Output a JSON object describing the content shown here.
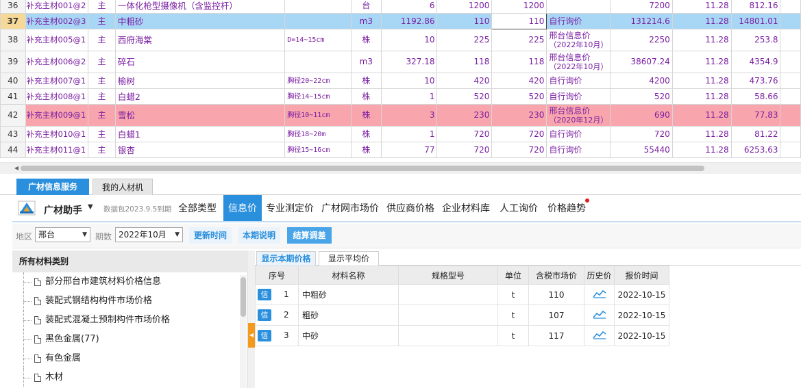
{
  "grid_rows": [
    {
      "row": "36",
      "code": "补充主材001@2",
      "type": "主",
      "name": "一体化枪型摄像机（含监控杆）",
      "spec": "",
      "unit": "台",
      "qty": "6",
      "price1": "1200",
      "price2": "1200",
      "source1": "",
      "source2": "",
      "amount": "7200",
      "rate": "11.28",
      "tax": "812.16",
      "style": "cut"
    },
    {
      "row": "37",
      "code": "补充主材002@3",
      "type": "主",
      "name": "中粗砂",
      "spec": "",
      "unit": "m3",
      "qty": "1192.86",
      "price1": "110",
      "price2": "110",
      "source1": "自行询价",
      "source2": "",
      "amount": "131214.6",
      "rate": "11.28",
      "tax": "14801.01",
      "style": "sel"
    },
    {
      "row": "38",
      "code": "补充主材005@1",
      "type": "主",
      "name": "西府海棠",
      "spec": "D=14~15cm",
      "unit": "株",
      "qty": "10",
      "price1": "225",
      "price2": "225",
      "source1": "邢台信息价",
      "source2": "（2022年10月）",
      "amount": "2250",
      "rate": "11.28",
      "tax": "253.8",
      "style": "tall"
    },
    {
      "row": "39",
      "code": "补充主材006@2",
      "type": "主",
      "name": "碎石",
      "spec": "",
      "unit": "m3",
      "qty": "327.18",
      "price1": "118",
      "price2": "118",
      "source1": "邢台信息价",
      "source2": "（2022年10月）",
      "amount": "38607.24",
      "rate": "11.28",
      "tax": "4354.9",
      "style": "tall"
    },
    {
      "row": "40",
      "code": "补充主材007@1",
      "type": "主",
      "name": "榆树",
      "spec": "胸径20~22cm",
      "unit": "株",
      "qty": "10",
      "price1": "420",
      "price2": "420",
      "source1": "自行询价",
      "source2": "",
      "amount": "4200",
      "rate": "11.28",
      "tax": "473.76",
      "style": "normal"
    },
    {
      "row": "41",
      "code": "补充主材008@1",
      "type": "主",
      "name": "白蜡2",
      "spec": "胸径14~15cm",
      "unit": "株",
      "qty": "1",
      "price1": "520",
      "price2": "520",
      "source1": "自行询价",
      "source2": "",
      "amount": "520",
      "rate": "11.28",
      "tax": "58.66",
      "style": "normal"
    },
    {
      "row": "42",
      "code": "补充主材009@1",
      "type": "主",
      "name": "雪松",
      "spec": "胸径10~11cm",
      "unit": "株",
      "qty": "3",
      "price1": "230",
      "price2": "230",
      "source1": "邢台信息价",
      "source2": "（2020年12月）",
      "amount": "690",
      "rate": "11.28",
      "tax": "77.83",
      "style": "pink"
    },
    {
      "row": "43",
      "code": "补充主材010@1",
      "type": "主",
      "name": "白蜡1",
      "spec": "胸径18~20m",
      "unit": "株",
      "qty": "1",
      "price1": "720",
      "price2": "720",
      "source1": "自行询价",
      "source2": "",
      "amount": "720",
      "rate": "11.28",
      "tax": "81.22",
      "style": "normal"
    },
    {
      "row": "44",
      "code": "补充主材011@1",
      "type": "主",
      "name": "银杏",
      "spec": "胸径15~16cm",
      "unit": "株",
      "qty": "77",
      "price1": "720",
      "price2": "720",
      "source1": "自行询价",
      "source2": "",
      "amount": "55440",
      "rate": "11.28",
      "tax": "6253.63",
      "style": "normal"
    }
  ],
  "tabs": {
    "active": "广材信息服务",
    "inactive": "我的人材机"
  },
  "assistant": {
    "name": "广材助手",
    "package_info": "数据包2023.9.5到期",
    "nav": [
      "全部类型",
      "信息价",
      "专业测定价",
      "广材网市场价",
      "供应商价格",
      "企业材料库",
      "人工询价",
      "价格趋势"
    ],
    "active_nav": "信息价",
    "icons": {
      "logo": "guangcai-logo-icon",
      "dropdown": "caret-down-icon",
      "notify": "red-dot-icon"
    },
    "colors": {
      "accent": "#2a8fdc",
      "notify": "#e02020"
    }
  },
  "filters": {
    "region_label": "地区",
    "region_value": "邢台",
    "period_label": "期数",
    "period_value": "2022年10月",
    "btn_update_time": "更新时间",
    "btn_period_note": "本期说明",
    "btn_settle": "结算调差"
  },
  "categories": {
    "header": "所有材料类别",
    "items": [
      "部分邢台市建筑材料价格信息",
      "装配式钢结构构件市场价格",
      "装配式混凝土预制构件市场价格",
      "黑色金属(77)",
      "有色金属",
      "木材"
    ]
  },
  "price_panel": {
    "tabs": [
      "显示本期价格",
      "显示平均价"
    ],
    "columns": [
      "序号",
      "材料名称",
      "规格型号",
      "单位",
      "含税市场价",
      "历史价",
      "报价时间"
    ],
    "badge": "信",
    "rows": [
      {
        "seq": "1",
        "name": "中粗砂",
        "spec": "",
        "unit": "t",
        "price": "110",
        "date": "2022-10-15"
      },
      {
        "seq": "2",
        "name": "粗砂",
        "spec": "",
        "unit": "t",
        "price": "107",
        "date": "2022-10-15"
      },
      {
        "seq": "3",
        "name": "中砂",
        "spec": "",
        "unit": "t",
        "price": "117",
        "date": "2022-10-15"
      }
    ]
  },
  "colors": {
    "row_selected": "#a8d6f5",
    "row_pink": "#f8a5ad",
    "grid_text": "#7a1fa2"
  }
}
